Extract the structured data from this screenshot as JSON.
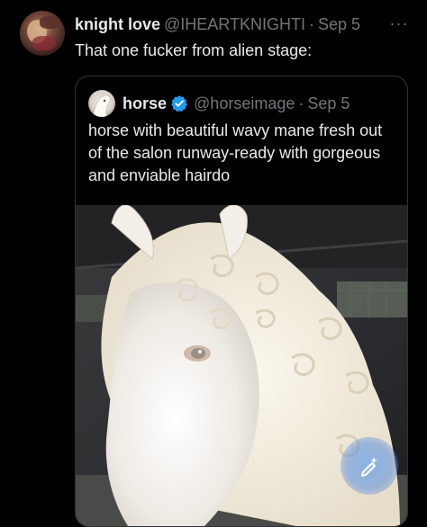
{
  "post": {
    "author_name": "knight love",
    "author_handle": "@IHEARTKNIGHTI",
    "separator": "·",
    "date": "Sep 5",
    "more": "···",
    "text": "That one fucker from alien stage:"
  },
  "quoted_post": {
    "author_name": "horse",
    "author_handle": "@horseimage",
    "separator": "·",
    "date": "Sep 5",
    "text": "horse with beautiful wavy mane fresh out of the salon runway-ready with gorgeous and enviable hairdo",
    "verified_color": "#1d9bf0",
    "image_subject": "white horse with curly mane"
  },
  "overlay": {
    "icon": "sparkle-edit-icon"
  }
}
